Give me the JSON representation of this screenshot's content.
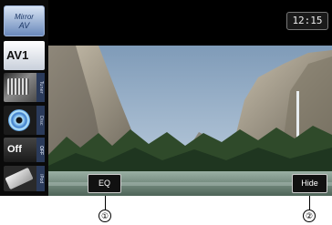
{
  "sidebar": {
    "items": [
      {
        "name": "Mirror AV",
        "line1": "Mirror",
        "line2": "AV"
      },
      {
        "name": "AV1",
        "label": "AV1"
      },
      {
        "name": "Tuner",
        "tab": "Tuner"
      },
      {
        "name": "Disc",
        "tab": "Disc"
      },
      {
        "name": "OFF",
        "label": "Off",
        "tab": "OFF"
      },
      {
        "name": "iPod",
        "tab": "iPod"
      }
    ]
  },
  "header": {
    "clock": "12:15"
  },
  "buttons": {
    "eq_label": "EQ",
    "hide_label": "Hide"
  },
  "callouts": [
    "①",
    "②"
  ],
  "colors": {
    "background": "#000000",
    "button_border": "#cccccc",
    "sidebar_tab": "#2a3a5a"
  }
}
